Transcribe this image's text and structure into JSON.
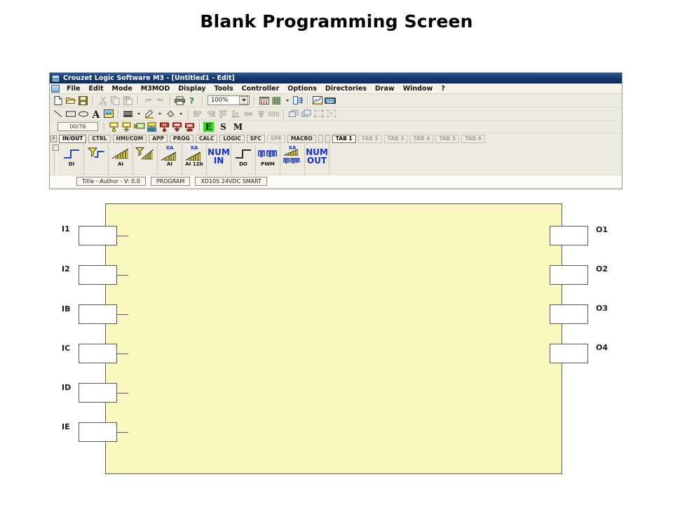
{
  "slide": {
    "title": "Blank Programming Screen"
  },
  "window": {
    "title": "Crouzet Logic Software M3 - [Untitled1 - Edit]",
    "app_icon": "application-icon"
  },
  "menu": {
    "items": [
      {
        "label": "File"
      },
      {
        "label": "Edit"
      },
      {
        "label": "Mode"
      },
      {
        "label": "M3MOD"
      },
      {
        "label": "Display"
      },
      {
        "label": "Tools"
      },
      {
        "label": "Controller"
      },
      {
        "label": "Options"
      },
      {
        "label": "Directories"
      },
      {
        "label": "Draw"
      },
      {
        "label": "Window"
      },
      {
        "label": "?"
      }
    ]
  },
  "toolbar_standard": {
    "icons": [
      "new-document-icon",
      "open-folder-icon",
      "save-disk-icon",
      "cut-scissors-icon",
      "copy-icon",
      "paste-icon",
      "undo-arrow-icon",
      "redo-arrow-icon",
      "print-icon",
      "help-question-icon"
    ],
    "zoom": {
      "value": "100%",
      "dropdown_icon": "chevron-down-icon"
    },
    "view_icons": [
      "show-grid-icon",
      "grid-pattern-icon",
      "grid-dropdown-icon",
      "tree-view-icon",
      "chart-icon",
      "keyboard-icon"
    ]
  },
  "toolbar_draw": {
    "icons": [
      "line-icon",
      "rectangle-icon",
      "ellipse-icon",
      "text-a-icon",
      "image-icon",
      "line-weight-icon",
      "line-weight-dropdown-icon",
      "line-color-icon",
      "line-color-dropdown-icon",
      "fill-color-icon",
      "fill-color-dropdown-icon",
      "align-left-icon",
      "align-right-icon",
      "align-top-icon",
      "align-bottom-icon",
      "align-center-horizontal-icon",
      "align-center-vertical-icon",
      "distribute-icon",
      "bring-front-icon",
      "send-back-icon",
      "group-icon",
      "ungroup-icon"
    ]
  },
  "toolbar_status": {
    "counter": "00/76",
    "icons": [
      "input-block-icon",
      "output-block-icon",
      "link-block-icon",
      "display-block-icon",
      "red-block-icon",
      "red-down-block-icon",
      "red-flat-block-icon"
    ],
    "modes": [
      {
        "label": "E",
        "active": true
      },
      {
        "label": "S",
        "active": false
      },
      {
        "label": "M",
        "active": false
      }
    ]
  },
  "tabs": {
    "close_label": "x",
    "items": [
      {
        "label": "IN/OUT",
        "state": "selected"
      },
      {
        "label": "CTRL",
        "state": "normal"
      },
      {
        "label": "HMI/COM",
        "state": "normal"
      },
      {
        "label": "APP",
        "state": "normal"
      },
      {
        "label": "PROG",
        "state": "normal"
      },
      {
        "label": "CALC",
        "state": "normal"
      },
      {
        "label": "LOGIC",
        "state": "normal"
      },
      {
        "label": "SFC",
        "state": "normal"
      },
      {
        "label": "SPE",
        "state": "dim"
      },
      {
        "label": "MACRO",
        "state": "normal"
      }
    ],
    "page_tabs": [
      {
        "label": "TAB 1",
        "state": "selected"
      },
      {
        "label": "TAB 2",
        "state": "dim"
      },
      {
        "label": "TAB 3",
        "state": "dim"
      },
      {
        "label": "TAB 4",
        "state": "dim"
      },
      {
        "label": "TAB 5",
        "state": "dim"
      },
      {
        "label": "TAB 6",
        "state": "dim"
      }
    ]
  },
  "function_blocks": [
    {
      "label": "DI",
      "prefix": "",
      "icon": "digital-input-step-icon",
      "kind": "step"
    },
    {
      "label": "",
      "prefix": "",
      "icon": "filtered-input-icon",
      "kind": "filter"
    },
    {
      "label": "AI",
      "prefix": "",
      "icon": "analog-input-bars-icon",
      "kind": "bars"
    },
    {
      "label": "",
      "prefix": "",
      "icon": "filtered-analog-icon",
      "kind": "filterbars"
    },
    {
      "label": "AI",
      "prefix": "XA",
      "icon": "expansion-analog-in-icon",
      "kind": "bars"
    },
    {
      "label": "AI 12b",
      "prefix": "XA",
      "icon": "expansion-analog-12b-icon",
      "kind": "bars"
    },
    {
      "label": "NUM\nIN",
      "prefix": "",
      "icon": "numeric-input-icon",
      "kind": "text"
    },
    {
      "label": "DO",
      "prefix": "",
      "icon": "digital-output-step-icon",
      "kind": "step"
    },
    {
      "label": "PWM",
      "prefix": "",
      "icon": "pwm-output-icon",
      "kind": "pwm"
    },
    {
      "label": "",
      "prefix": "XA",
      "icon": "expansion-pwm-icon",
      "kind": "xapwm"
    },
    {
      "label": "NUM\nOUT",
      "prefix": "",
      "icon": "numeric-output-icon",
      "kind": "text"
    }
  ],
  "header_fields": [
    {
      "label": "Title - Author - V: 0.0"
    },
    {
      "label": "PROGRAM"
    },
    {
      "label": "XD10S 24VDC SMART"
    }
  ],
  "program": {
    "canvas_color": "#fbf8bf",
    "inputs": [
      {
        "label": "I1"
      },
      {
        "label": "I2"
      },
      {
        "label": "IB"
      },
      {
        "label": "IC"
      },
      {
        "label": "ID"
      },
      {
        "label": "IE"
      }
    ],
    "outputs": [
      {
        "label": "O1"
      },
      {
        "label": "O2"
      },
      {
        "label": "O3"
      },
      {
        "label": "O4"
      }
    ]
  },
  "colors": {
    "titlebar": "#16386d",
    "toolbar_bg": "#eceade",
    "canvas": "#fbf8bf",
    "accent_blue": "#1430c8",
    "mode_active": "#27e018"
  }
}
